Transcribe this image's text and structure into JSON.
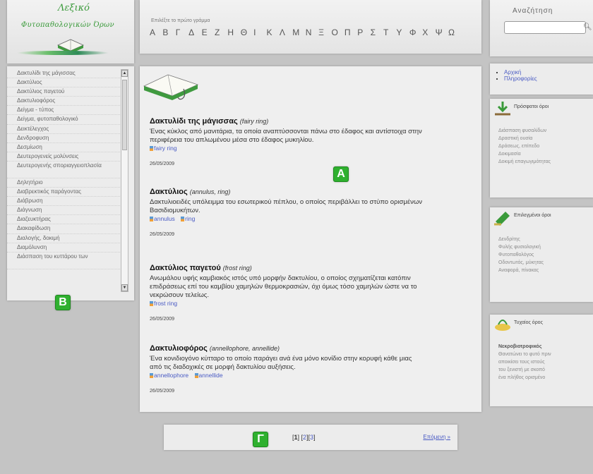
{
  "logo": {
    "line1": "Λεξικό",
    "line2": "Φυτοπαθολογικών Όρων"
  },
  "alphabet": {
    "hint": "Επιλέξτε το πρώτο γράμμα",
    "letters": [
      "Α",
      "Β",
      "Γ",
      "Δ",
      "Ε",
      "Ζ",
      "Η",
      "Θ",
      "Ι",
      "Κ",
      "Λ",
      "Μ",
      "Ν",
      "Ξ",
      "Ο",
      "Π",
      "Ρ",
      "Σ",
      "Τ",
      "Υ",
      "Φ",
      "Χ",
      "Ψ",
      "Ω"
    ]
  },
  "search": {
    "label": "Αναζήτηση",
    "value": "",
    "placeholder": ""
  },
  "terms": [
    "Δακτυλίδι της μάγισσας",
    "Δακτύλιος",
    "Δακτύλιος παγετού",
    "Δακτυλιοφόρος",
    "Δείγμα - τύπος",
    "Δείγμα, φυτοπαθολογικό",
    "Δεικτέλεγχος",
    "Δενδροφυση",
    "Δεσμίωση",
    "Δευτερογενείς μολύνσεις",
    "Δευτερογενής σποριαγγειοπλασία",
    "Δηλητήριο",
    "Διαβρεκτικός παράγοντας",
    "Διάβρωση",
    "Διάγνωση",
    "Διαζευκτήρας",
    "Διακαφίδωση",
    "Διαλογής, δοκιμή",
    "Διαμόλυνση",
    "Διάσπαση του κυττάρου των"
  ],
  "entries": [
    {
      "title": "Δακτυλίδι της μάγισσας",
      "english": "(fairy ring)",
      "definition": "Ένας κύκλος από μανιτάρια, τα οποία αναπτύσσονται πάνω στο έδαφος και αντίστοιχα στην περιφέρεια του απλωμένου μέσα στο έδαφος μυκηλίου.",
      "links": [
        "fairy ring"
      ],
      "date": "26/05/2009"
    },
    {
      "title": "Δακτύλιος",
      "english": "(annulus, ring)",
      "definition": "Δακτυλιοειδές υπόλειμμα του εσωτερικού πέπλου, ο οποίος περιβάλλει το στύπο ορισμένων Βασιδιομυκήτων.",
      "links": [
        "annulus",
        "ring"
      ],
      "date": "26/05/2009"
    },
    {
      "title": "Δακτύλιος παγετού",
      "english": "(frost ring)",
      "definition": "Ανωμάλου υφής καμβιακός ιστός υπό μορφήν δακτυλίου, ο οποίος σχηματίζεται κατόπιν επιδράσεως επί του καμβίου χαμηλών θερμοκρασιών, όχι όμως τόσο χαμηλών ώστε να το νεκρώσουν τελείως.",
      "links": [
        "frost ring"
      ],
      "date": "26/05/2009"
    },
    {
      "title": "Δακτυλιοφόρος",
      "english": "(annellophore, annellide)",
      "definition": "Ένα κονιδιογόνο κύτταρο το οποίο παράγει ανά ένα μόνο κονίδιο στην κορυφή κάθε μιας από τις διαδοχικές σε μορφή δακτυλίου αυξήσεις.",
      "links": [
        "annellophore",
        "annellide"
      ],
      "date": "26/05/2009"
    }
  ],
  "markers": {
    "a": "Α",
    "b": "Β",
    "c": "Γ"
  },
  "pagination": {
    "current": "1",
    "pages": [
      "2",
      "3"
    ],
    "next": "Επόμενη »"
  },
  "nav": {
    "items": [
      "Αρχική",
      "Πληροφορίες"
    ]
  },
  "boxes": [
    {
      "title": "Πρόσφατοι όροι",
      "lines": [
        "Διάσπαση φυσαλίδων",
        "Δραστική ουσία",
        "Δράσεως, επίπεδο",
        "Δοκιμασία",
        "Δοκιμή επαγωγιμότητας"
      ]
    },
    {
      "title": "Επιλεγμένοι όροι",
      "lines": [
        "Δενδρίτης",
        "Φυλής φυσιολογική",
        "Φυτοπαθολόγος",
        "Οδοντωτός, μύκητας",
        "Αναφορά, πίνακας"
      ]
    },
    {
      "title": "Τυχαίος όρος",
      "term": "Νεκροβιοτροφικός",
      "lines": [
        "Θανατώνει το φυτό πριν",
        "αποικίσει τους ιστούς",
        "του ξενιστή με σκοπό",
        "ένα πλήθος ορισμένο"
      ]
    }
  ]
}
